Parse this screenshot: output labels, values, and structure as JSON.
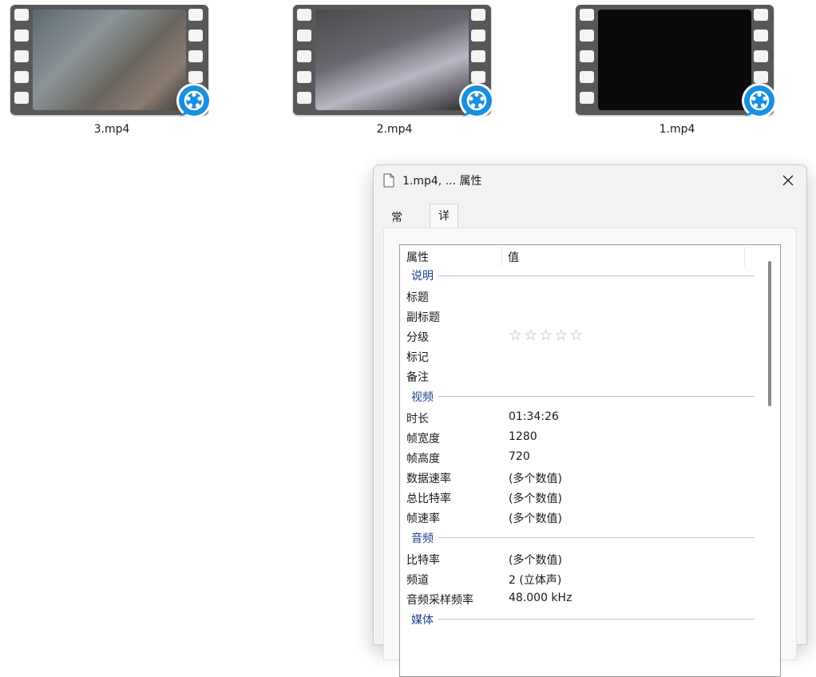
{
  "files": [
    {
      "name": "3.mp4"
    },
    {
      "name": "2.mp4"
    },
    {
      "name": "1.mp4"
    }
  ],
  "dialog": {
    "title": "1.mp4, ... 属性",
    "tabs": [
      "常规",
      "详细信息"
    ],
    "active_tab": "详细信息",
    "columns": {
      "property": "属性",
      "value": "值"
    },
    "sections": {
      "description": "说明",
      "video": "视频",
      "audio": "音频",
      "media": "媒体"
    },
    "description_rows": [
      {
        "key": "标题",
        "value": ""
      },
      {
        "key": "副标题",
        "value": ""
      },
      {
        "key": "分级",
        "value": ""
      },
      {
        "key": "标记",
        "value": ""
      },
      {
        "key": "备注",
        "value": ""
      }
    ],
    "rating": {
      "stars": 0,
      "max": 5,
      "glyphs": "☆☆☆☆☆"
    },
    "video_rows": [
      {
        "key": "时长",
        "value": "01:34:26"
      },
      {
        "key": "帧宽度",
        "value": "1280"
      },
      {
        "key": "帧高度",
        "value": "720"
      },
      {
        "key": "数据速率",
        "value": "(多个数值)"
      },
      {
        "key": "总比特率",
        "value": "(多个数值)"
      },
      {
        "key": "帧速率",
        "value": "(多个数值)"
      }
    ],
    "audio_rows": [
      {
        "key": "比特率",
        "value": "(多个数值)"
      },
      {
        "key": "频道",
        "value": "2 (立体声)"
      },
      {
        "key": "音频采样频率",
        "value": "48.000 kHz"
      }
    ]
  },
  "colors": {
    "section_title": "#1e3f8a",
    "badge_blue": "#1a8fe0",
    "star": "#b4b4b4"
  }
}
